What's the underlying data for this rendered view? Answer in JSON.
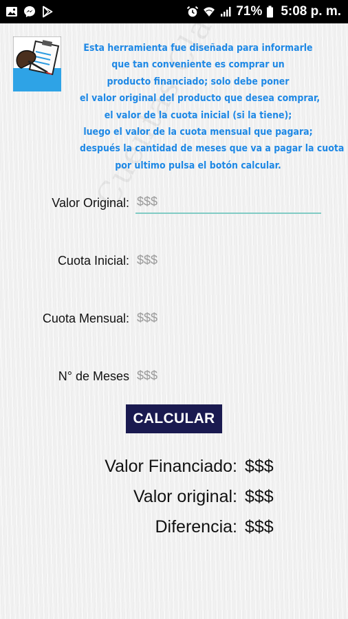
{
  "status_bar": {
    "battery": "71%",
    "time": "5:08 p. m.",
    "left_icons": [
      "gallery-icon",
      "messenger-icon",
      "play-store-icon"
    ],
    "right_icons": [
      "alarm-icon",
      "wifi-icon",
      "signal-icon",
      "battery-icon"
    ]
  },
  "watermark": "Cuentas Claras",
  "intro": {
    "lines": [
      "Esta herramienta fue diseñada para informarle",
      "que tan conveniente es comprar un",
      "producto financiado; solo debe poner",
      "el valor original del producto que desea comprar,",
      "el valor de la cuota inicial (si la tiene);",
      "luego el valor de la cuota mensual que pagara;",
      "después la cantidad de meses que va a pagar la cuota",
      "por ultimo pulsa el botón calcular."
    ],
    "color": "#1e88e5"
  },
  "form": {
    "valor_original": {
      "label": "Valor Original:",
      "placeholder": "$$$",
      "value": ""
    },
    "cuota_inicial": {
      "label": "Cuota Inicial:",
      "placeholder": "$$$",
      "value": ""
    },
    "cuota_mensual": {
      "label": "Cuota Mensual:",
      "placeholder": "$$$",
      "value": ""
    },
    "meses": {
      "label": "N° de Meses",
      "placeholder": "$$$",
      "value": ""
    }
  },
  "calcular_button": {
    "label": "CALCULAR",
    "color": "#1a1a50"
  },
  "results": {
    "valor_financiado": {
      "label": "Valor Financiado:",
      "value": "$$$"
    },
    "valor_original": {
      "label": "Valor original:",
      "value": "$$$"
    },
    "diferencia": {
      "label": "Diferencia:",
      "value": "$$$"
    }
  },
  "accent_color": "#80cbc4"
}
